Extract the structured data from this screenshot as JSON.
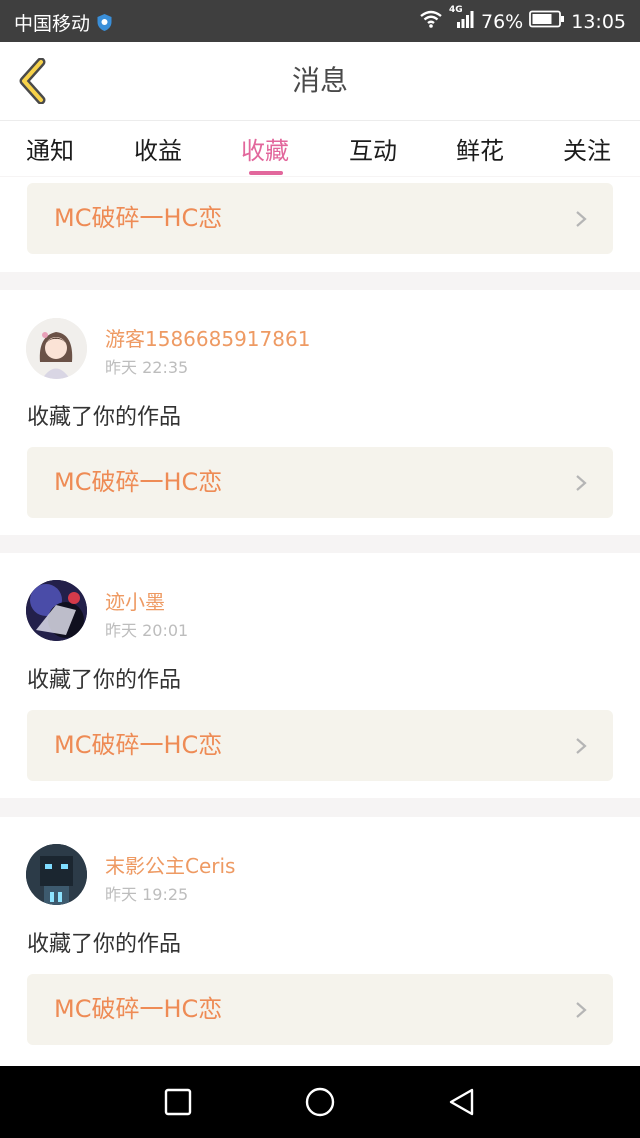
{
  "status_bar": {
    "carrier": "中国移动",
    "network": "4G",
    "battery": "76%",
    "time": "13:05",
    "icons": [
      "shield-icon",
      "wifi-icon",
      "signal-icon",
      "battery-icon"
    ]
  },
  "header": {
    "title": "消息",
    "back_icon": "chevron-left-icon"
  },
  "tabs": {
    "items": [
      {
        "label": "通知"
      },
      {
        "label": "收益"
      },
      {
        "label": "收藏"
      },
      {
        "label": "互动"
      },
      {
        "label": "鲜花"
      },
      {
        "label": "关注"
      }
    ],
    "active": "收藏"
  },
  "messages": [
    {
      "work_title": "MC破碎一HC恋"
    },
    {
      "username": "游客1586685917861",
      "time": "昨天 22:35",
      "action": "收藏了你的作品",
      "work_title": "MC破碎一HC恋"
    },
    {
      "username": "迹小墨",
      "time": "昨天 20:01",
      "action": "收藏了你的作品",
      "work_title": "MC破碎一HC恋"
    },
    {
      "username": "末影公主Ceris",
      "time": "昨天 19:25",
      "action": "收藏了你的作品",
      "work_title": "MC破碎一HC恋"
    }
  ],
  "nav_bar": {
    "icons": [
      "recent-apps-icon",
      "home-icon",
      "back-icon"
    ]
  },
  "colors": {
    "accent": "#e2679c",
    "username": "#ee9a63",
    "work_title": "#ee8b55",
    "work_box": "#f5f3ec",
    "separator": "#f6f4f4"
  }
}
